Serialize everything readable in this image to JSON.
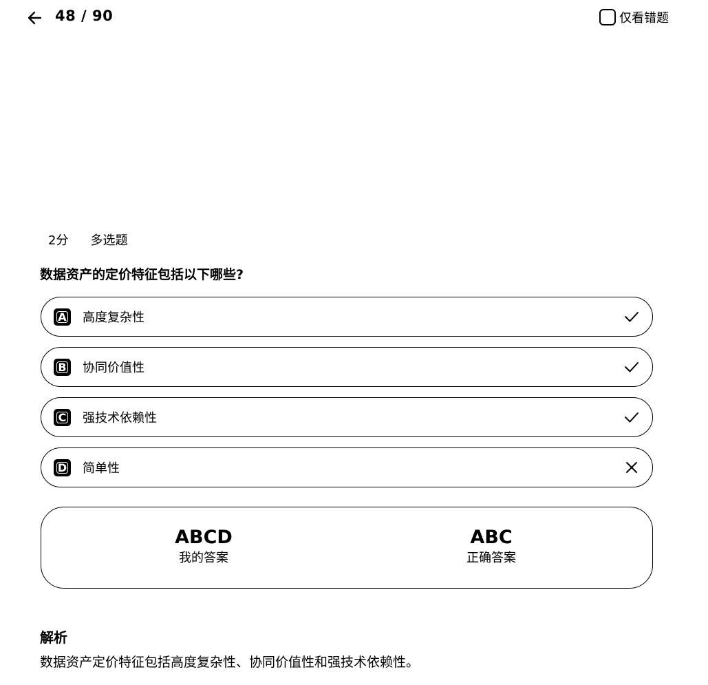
{
  "header": {
    "progress": "48 / 90",
    "wrong_only_label": "仅看错题"
  },
  "question": {
    "score": "2分",
    "type": "多选题",
    "text": "数据资产的定价特征包括以下哪些?"
  },
  "options": [
    {
      "letter": "A",
      "text": "高度复杂性",
      "mark": "check-icon"
    },
    {
      "letter": "B",
      "text": "协同价值性",
      "mark": "check-icon"
    },
    {
      "letter": "C",
      "text": "强技术依赖性",
      "mark": "check-icon"
    },
    {
      "letter": "D",
      "text": "简单性",
      "mark": "close-icon"
    }
  ],
  "answers": {
    "mine_value": "ABCD",
    "mine_label": "我的答案",
    "correct_value": "ABC",
    "correct_label": "正确答案"
  },
  "analysis": {
    "title": "解析",
    "text": "数据资产定价特征包括高度复杂性、协同价值性和强技术依赖性。"
  }
}
